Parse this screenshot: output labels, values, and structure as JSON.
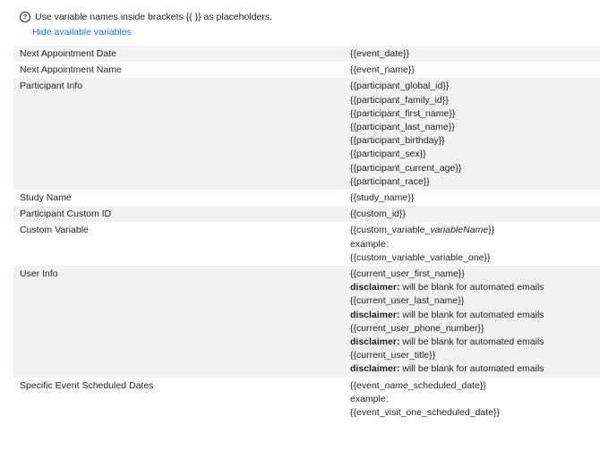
{
  "hint": {
    "icon": "question-circle-icon",
    "text": "Use variable names inside brackets {{ }} as placeholders."
  },
  "toggle_label": "Hide available variables",
  "rows": [
    {
      "name": "Next Appointment Date",
      "shaded": true,
      "lines": [
        {
          "text": "{{event_date}}"
        }
      ]
    },
    {
      "name": "Next Appointment Name",
      "shaded": false,
      "lines": [
        {
          "text": "{{event_name}}"
        }
      ]
    },
    {
      "name": "Participant Info",
      "shaded": true,
      "lines": [
        {
          "text": "{{participant_global_id}}"
        },
        {
          "text": "{{participant_family_id}}"
        },
        {
          "text": "{{participant_first_name}}"
        },
        {
          "text": "{{participant_last_name}}"
        },
        {
          "text": "{{participant_birthday}}"
        },
        {
          "text": "{{participant_sex}}"
        },
        {
          "text": "{{participant_current_age}}"
        },
        {
          "text": "{{participant_race}}"
        }
      ]
    },
    {
      "name": "Study Name",
      "shaded": false,
      "lines": [
        {
          "text": "{{study_name}}"
        }
      ]
    },
    {
      "name": "Participant Custom ID",
      "shaded": true,
      "lines": [
        {
          "text": "{{custom_id}}"
        }
      ]
    },
    {
      "name": "Custom Variable",
      "shaded": false,
      "lines": [
        {
          "pre": "{{custom_variable_",
          "em": "variableName",
          "post": "}}"
        },
        {
          "text": "example:"
        },
        {
          "text": "{{custom_variable_variable_one}}"
        }
      ]
    },
    {
      "name": "User Info",
      "shaded": true,
      "lines": [
        {
          "text": "{{current_user_first_name}}"
        },
        {
          "bold": "disclaimer:",
          "rest": " will be blank for automated emails"
        },
        {
          "text": "{{current_user_last_name}}"
        },
        {
          "bold": "disclaimer:",
          "rest": " will be blank for automated emails"
        },
        {
          "text": "{{current_user_phone_number}}"
        },
        {
          "bold": "disclaimer:",
          "rest": " will be blank for automated emails"
        },
        {
          "text": "{{current_user_title}}"
        },
        {
          "bold": "disclaimer:",
          "rest": " will be blank for automated emails"
        }
      ]
    },
    {
      "name": "Specific Event Scheduled Dates",
      "shaded": false,
      "lines": [
        {
          "pre": "{{event_",
          "em": "name",
          "post": "_scheduled_date}}"
        },
        {
          "text": "example:"
        },
        {
          "text": "{{event_visit_one_scheduled_date}}"
        }
      ]
    }
  ]
}
